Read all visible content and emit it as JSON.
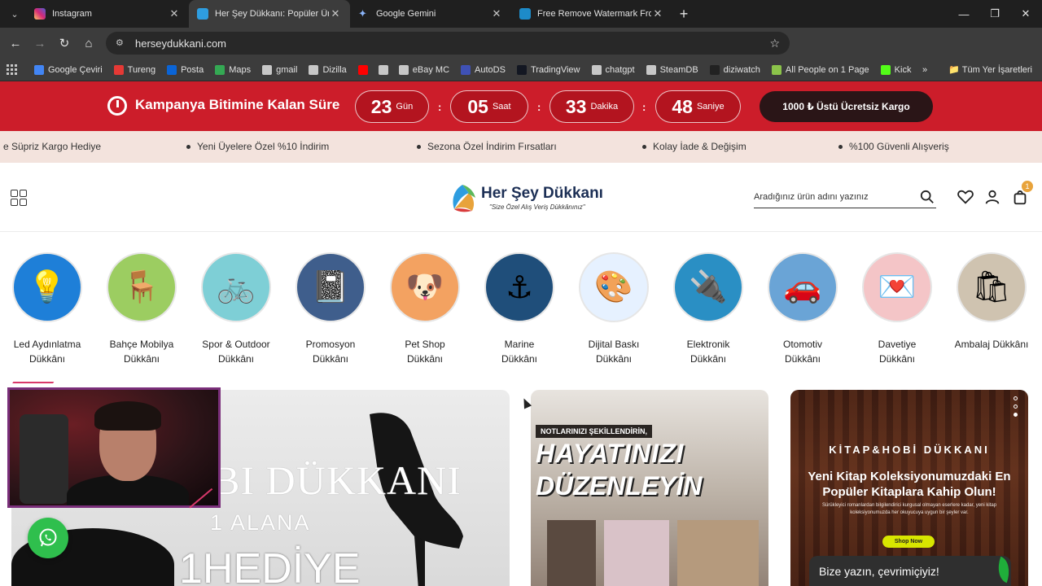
{
  "browser": {
    "tabs": [
      {
        "title": "Instagram",
        "color": "#d62976",
        "active": false
      },
      {
        "title": "Her Şey Dükkanı: Popüler Ürünler",
        "color": "#2e9de0",
        "active": true
      },
      {
        "title": "Google Gemini",
        "color": "#4b8df8",
        "active": false
      },
      {
        "title": "Free Remove Watermark From Image",
        "color": "#1d8bc9",
        "active": false
      }
    ],
    "url": "herseydukkani.com",
    "bookmarks": [
      {
        "label": "Google Çeviri",
        "color": "#4285f4"
      },
      {
        "label": "Tureng",
        "color": "#e53935"
      },
      {
        "label": "Posta",
        "color": "#0a64d6"
      },
      {
        "label": "Maps",
        "color": "#34a853"
      },
      {
        "label": "gmail",
        "color": "#c7c7c7"
      },
      {
        "label": "Dizilla",
        "color": "#c7c7c7"
      },
      {
        "label": "",
        "color": "#ff0000"
      },
      {
        "label": "",
        "color": "#c7c7c7"
      },
      {
        "label": "eBay MC",
        "color": "#c7c7c7"
      },
      {
        "label": "AutoDS",
        "color": "#3f51b5"
      },
      {
        "label": "TradingView",
        "color": "#131722"
      },
      {
        "label": "chatgpt",
        "color": "#c7c7c7"
      },
      {
        "label": "SteamDB",
        "color": "#c7c7c7"
      },
      {
        "label": "diziwatch",
        "color": "#222222"
      },
      {
        "label": "All People on 1 Page",
        "color": "#8bc34a"
      },
      {
        "label": "Kick",
        "color": "#53fc18"
      }
    ],
    "all_bookmarks": "Tüm Yer İşaretleri"
  },
  "campaign": {
    "title": "Kampanya Bitimine Kalan Süre",
    "countdown": [
      {
        "num": "23",
        "unit": "Gün"
      },
      {
        "num": "05",
        "unit": "Saat"
      },
      {
        "num": "33",
        "unit": "Dakika"
      },
      {
        "num": "48",
        "unit": "Saniye"
      }
    ],
    "separator": ":",
    "cargo": "1000 ₺ Üstü Ücretsiz Kargo"
  },
  "ticker": [
    "e Süpriz Kargo Hediye",
    "Yeni Üyelere Özel %10 İndirim",
    "Sezona Özel İndirim Fırsatları",
    "Kolay İade & Değişim",
    "%100 Güvenli Alışveriş"
  ],
  "header": {
    "logo_title": "Her Şey Dükkanı",
    "logo_subtitle": "\"Size Özel Alış Veriş Dükkânınız\"",
    "search_placeholder": "Aradığınız ürün adını yazınız",
    "cart_count": "1"
  },
  "categories": [
    {
      "line1": "Led Aydınlatma",
      "line2": "Dükkânı",
      "color": "#1e7fd8"
    },
    {
      "line1": "Bahçe Mobilya",
      "line2": "Dükkânı",
      "color": "#9ccd61"
    },
    {
      "line1": "Spor & Outdoor",
      "line2": "Dükkânı",
      "color": "#7ecfd6"
    },
    {
      "line1": "Promosyon",
      "line2": "Dükkânı",
      "color": "#3f5e8c"
    },
    {
      "line1": "Pet Shop",
      "line2": "Dükkânı",
      "color": "#f3a261"
    },
    {
      "line1": "Marine",
      "line2": "Dükkânı",
      "color": "#1f4e7a"
    },
    {
      "line1": "Dijital Baskı",
      "line2": "Dükkânı",
      "color": "#e6f1ff"
    },
    {
      "line1": "Elektronik",
      "line2": "Dükkânı",
      "color": "#2a8fc4"
    },
    {
      "line1": "Otomotiv",
      "line2": "Dükkânı",
      "color": "#6aa4d6"
    },
    {
      "line1": "Davetiye",
      "line2": "Dükkânı",
      "color": "#f4c5c7"
    },
    {
      "line1": "Ambalaj Dükkânı",
      "line2": "",
      "color": "#cfc3b0"
    }
  ],
  "banners": {
    "left": {
      "title": "ABI DÜKKANI",
      "line2": "1 ALANA",
      "line3": "1HEDİYE"
    },
    "middle": {
      "tag": "NOTLARINIZI ŞEKİLLENDİRİN,",
      "line1": "HAYATINIZI",
      "line2": "DÜZENLEYİN"
    },
    "right": {
      "brand": "KİTAP&HOBİ DÜKKANI",
      "headline": "Yeni Kitap Koleksiyonumuzdaki En Popüler Kitaplara Kahip Olun!",
      "description": "Sürükleyici romanlardan bilgilendirici kurgusal olmayan eserlere kadar, yeni kitap koleksiyonumuzda her okuyucuya uygun bir şeyler var.",
      "button": "Shop Now"
    }
  },
  "chat": {
    "label": "Bize yazın, çevrimiçiyiz!"
  }
}
